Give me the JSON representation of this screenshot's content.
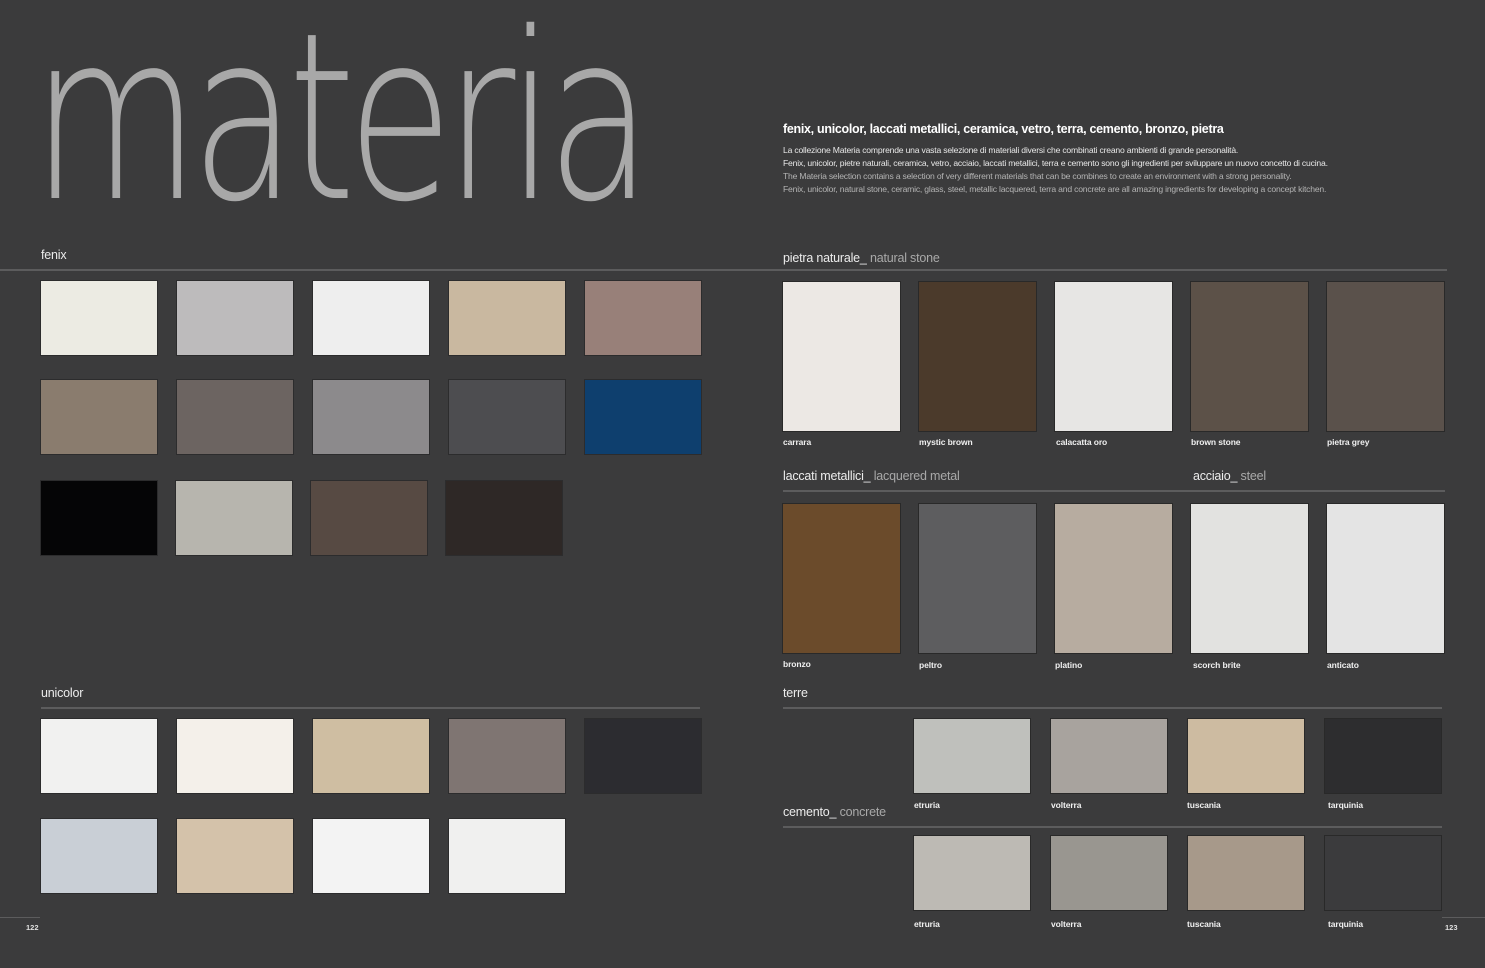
{
  "title": "materia",
  "intro": {
    "subtitle": "fenix, unicolor, laccati metallici, ceramica, vetro, terra, cemento, bronzo, pietra",
    "it_line1": "La collezione Materia comprende una vasta selezione di materiali diversi che combinati creano ambienti di grande personalità.",
    "it_line2": "Fenix, unicolor, pietre naturali, ceramica, vetro, acciaio, laccati metallici, terra e cemento sono gli ingredienti per sviluppare un nuovo concetto di cucina.",
    "en_line1": "The Materia selection contains a selection of very different materials that can be combines to create an environment with a strong personality.",
    "en_line2": "Fenix, unicolor, natural stone, ceramic, glass, steel, metallic lacquered, terra and concrete are all amazing ingredients for developing a concept kitchen."
  },
  "sections": {
    "fenix": {
      "label": "fenix"
    },
    "unicolor": {
      "label": "unicolor"
    },
    "pietra": {
      "label": "pietra naturale_",
      "sub": "natural stone"
    },
    "laccati": {
      "label": "laccati metallici_",
      "sub": "lacquered metal"
    },
    "acciaio": {
      "label": "acciaio_",
      "sub": "steel"
    },
    "terre": {
      "label": "terre"
    },
    "cemento": {
      "label": "cemento_",
      "sub": "concrete"
    }
  },
  "fenix_colors": [
    "#ecebe3",
    "#bdbbbc",
    "#eeeeee",
    "#c9b8a0",
    "#988079",
    "#8a7c6e",
    "#6c6461",
    "#8c8a8c",
    "#4d4d50",
    "#0e3f6e",
    "#050506",
    "#b7b5ae",
    "#574a43",
    "#2e2826"
  ],
  "unicolor_colors": [
    "#f1f1f0",
    "#f4f0ea",
    "#cfbea2",
    "#7f7572",
    "#2c2c30",
    "#c9cfd6",
    "#d4c2aa",
    "#f3f3f3",
    "#f0f0ef"
  ],
  "pietra": [
    {
      "label": "carrara",
      "color": "#ece8e4"
    },
    {
      "label": "mystic brown",
      "color": "#4b3a2b"
    },
    {
      "label": "calacatta oro",
      "color": "#e7e6e4"
    },
    {
      "label": "brown stone",
      "color": "#5c5148"
    },
    {
      "label": "pietra grey",
      "color": "#5a514b"
    }
  ],
  "metal": [
    {
      "label": "bronzo",
      "color": "#6b4b2b"
    },
    {
      "label": "peltro",
      "color": "#5d5d5f"
    },
    {
      "label": "platino",
      "color": "#b7aca0"
    },
    {
      "label": "scorch brite",
      "color": "#e2e2e0"
    },
    {
      "label": "anticato",
      "color": "#e4e4e4"
    }
  ],
  "terre": [
    {
      "label": "etruria",
      "color": "#bfc0bc"
    },
    {
      "label": "volterra",
      "color": "#a8a39e"
    },
    {
      "label": "tuscania",
      "color": "#cdbba1"
    },
    {
      "label": "tarquinia",
      "color": "#2d2d2f"
    }
  ],
  "cemento": [
    {
      "label": "etruria",
      "color": "#bdbab4"
    },
    {
      "label": "volterra",
      "color": "#999690"
    },
    {
      "label": "tuscania",
      "color": "#a7998a"
    },
    {
      "label": "tarquinia",
      "color": "#3b3b3d"
    }
  ],
  "page_left": "122",
  "page_right": "123"
}
